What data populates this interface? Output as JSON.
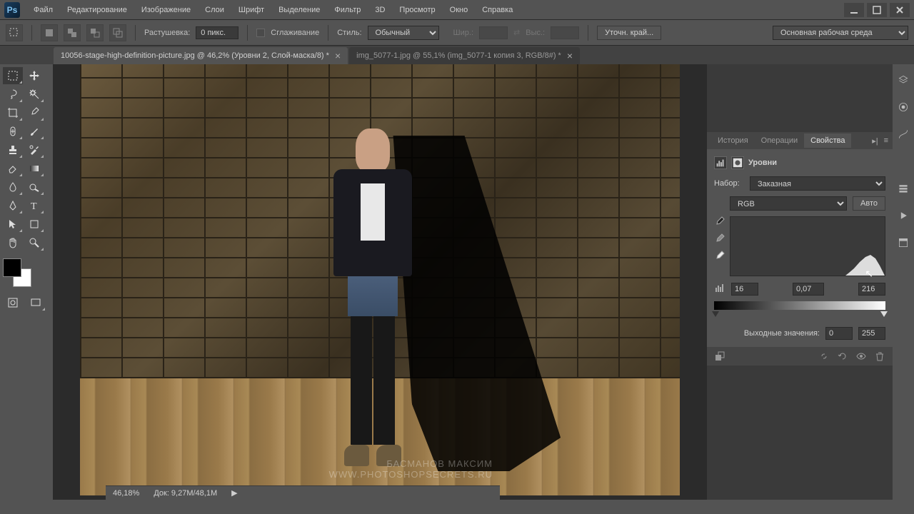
{
  "app": {
    "logo": "Ps"
  },
  "menu": [
    "Файл",
    "Редактирование",
    "Изображение",
    "Слои",
    "Шрифт",
    "Выделение",
    "Фильтр",
    "3D",
    "Просмотр",
    "Окно",
    "Справка"
  ],
  "optionsBar": {
    "featherLabel": "Растушевка:",
    "featherValue": "0 пикс.",
    "antialiasLabel": "Сглаживание",
    "styleLabel": "Стиль:",
    "styleValue": "Обычный",
    "widthLabel": "Шир.:",
    "heightLabel": "Выс.:",
    "refineEdge": "Уточн. край...",
    "workspace": "Основная рабочая среда"
  },
  "tabs": [
    {
      "label": "10056-stage-high-definition-picture.jpg @ 46,2% (Уровни 2, Слой-маска/8) *",
      "active": true
    },
    {
      "label": "img_5077-1.jpg @ 55,1% (img_5077-1 копия 3, RGB/8#) *",
      "active": false
    }
  ],
  "panels": {
    "tabs": [
      "История",
      "Операции",
      "Свойства"
    ],
    "activeTab": "Свойства",
    "propsTitle": "Уровни",
    "presetLabel": "Набор:",
    "presetValue": "Заказная",
    "channelValue": "RGB",
    "autoBtn": "Авто",
    "levels": {
      "black": "16",
      "mid": "0,07",
      "white": "216"
    },
    "outputLabel": "Выходные значения:",
    "output": {
      "black": "0",
      "white": "255"
    }
  },
  "status": {
    "zoom": "46,18%",
    "docInfo": "Док: 9,27M/48,1M"
  },
  "watermark": {
    "line1": "БАСМАНОВ МАКСИМ",
    "line2": "WWW.PHOTOSHOPSECRETS.RU"
  },
  "colors": {
    "fg": "#000000",
    "bg": "#ffffff"
  }
}
